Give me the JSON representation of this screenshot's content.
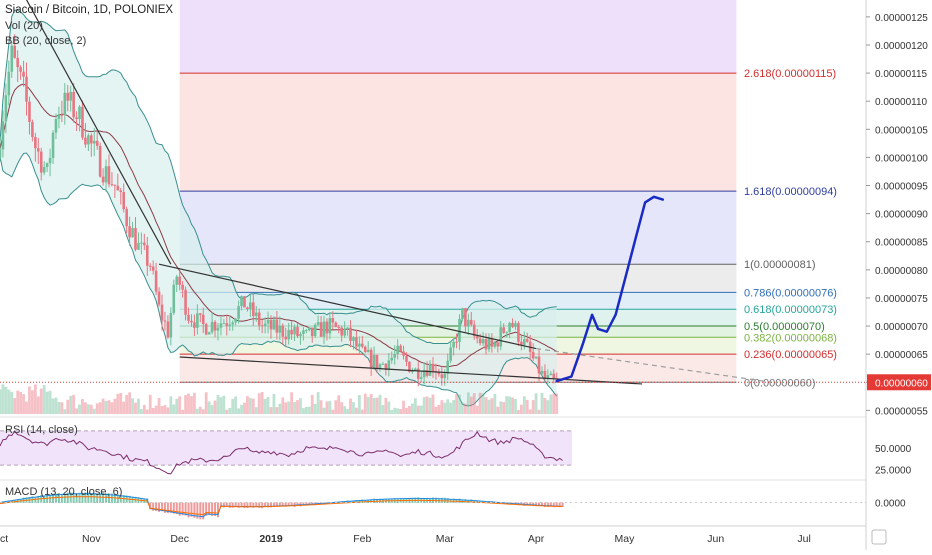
{
  "header": {
    "title": "Siacoin / Bitcoin, 1D, POLONIEX",
    "vol_label": "Vol (20)",
    "bb_label": "BB (20, close, 2)",
    "rsi_label": "RSI (14, close)",
    "macd_label": "MACD (13, 20, close, 6)"
  },
  "colors": {
    "up": "#6fbf9a",
    "down": "#e87682",
    "bb_band": "#3a8f8f",
    "bb_fill": "#d8f0ee",
    "fib_2618": "#d32f2f",
    "fib_1618": "#303f9f",
    "fib_1": "#616161",
    "fib_0786": "#2f6fb7",
    "fib_0618": "#26a69a",
    "fib_05": "#2e7d32",
    "fib_0382": "#7cb342",
    "fib_0236": "#d32f2f",
    "fib_0": "#757575",
    "projection": "#1a2bc4",
    "last_price": "#e53935",
    "rsi_line": "#7b2d6b",
    "macd_line": "#1e88e5",
    "signal_line": "#ff6d00"
  },
  "chart_data": {
    "type": "candlestick",
    "xlabels": [
      "Oct",
      "Nov",
      "Dec",
      "2019",
      "Feb",
      "Mar",
      "Apr",
      "May",
      "Jun",
      "Jul"
    ],
    "xlabel_days": [
      0,
      31,
      61,
      92,
      123,
      151,
      182,
      212,
      243,
      273
    ],
    "ylim": [
      5.4e-07,
      1.28e-06
    ],
    "yticks": [
      "0.00000055",
      "0.00000060",
      "0.00000065",
      "0.00000070",
      "0.00000075",
      "0.00000080",
      "0.00000085",
      "0.00000090",
      "0.00000095",
      "0.00000100",
      "0.00000105",
      "0.00000110",
      "0.00000115",
      "0.00000120",
      "0.00000125"
    ],
    "ytick_values": [
      5.5e-07,
      6e-07,
      6.5e-07,
      7e-07,
      7.5e-07,
      8e-07,
      8.5e-07,
      9e-07,
      9.5e-07,
      1e-06,
      1.05e-06,
      1.1e-06,
      1.15e-06,
      1.2e-06,
      1.25e-06
    ],
    "last_price_label": "0.00000060",
    "last_price": 6e-07,
    "price_path": [
      [
        0,
        1e-06
      ],
      [
        3,
        1.12e-06
      ],
      [
        5,
        1.18e-06
      ],
      [
        9,
        1.12e-06
      ],
      [
        13,
        1.02e-06
      ],
      [
        17,
        9.7e-07
      ],
      [
        20,
        1.08e-06
      ],
      [
        24,
        1.1e-06
      ],
      [
        28,
        1.07e-06
      ],
      [
        32,
        1.02e-06
      ],
      [
        36,
        9.8e-07
      ],
      [
        40,
        9.5e-07
      ],
      [
        44,
        8.9e-07
      ],
      [
        48,
        8.4e-07
      ],
      [
        52,
        8.1e-07
      ],
      [
        55,
        7.3e-07
      ],
      [
        58,
        6.9e-07
      ],
      [
        61,
        7.9e-07
      ],
      [
        65,
        7.2e-07
      ],
      [
        70,
        7e-07
      ],
      [
        78,
        7.1e-07
      ],
      [
        84,
        7.4e-07
      ],
      [
        90,
        7e-07
      ],
      [
        98,
        6.9e-07
      ],
      [
        105,
        6.8e-07
      ],
      [
        112,
        7e-07
      ],
      [
        118,
        6.9e-07
      ],
      [
        124,
        6.5e-07
      ],
      [
        130,
        6.3e-07
      ],
      [
        136,
        6.5e-07
      ],
      [
        142,
        6.2e-07
      ],
      [
        148,
        6.3e-07
      ],
      [
        152,
        6.1e-07
      ],
      [
        158,
        7.2e-07
      ],
      [
        162,
        6.8e-07
      ],
      [
        168,
        6.6e-07
      ],
      [
        174,
        7.1e-07
      ],
      [
        180,
        6.6e-07
      ],
      [
        183,
        6.3e-07
      ],
      [
        186,
        6.05e-07
      ],
      [
        189,
        6e-07
      ]
    ],
    "fib_levels": [
      {
        "label": "2.618(0.00000115)",
        "value": 1.15e-06,
        "color_key": "fib_2618"
      },
      {
        "label": "1.618(0.00000094)",
        "value": 9.4e-07,
        "color_key": "fib_1618"
      },
      {
        "label": "1(0.00000081)",
        "value": 8.1e-07,
        "color_key": "fib_1"
      },
      {
        "label": "0.786(0.00000076)",
        "value": 7.6e-07,
        "color_key": "fib_0786"
      },
      {
        "label": "0.618(0.00000073)",
        "value": 7.3e-07,
        "color_key": "fib_0618"
      },
      {
        "label": "0.5(0.00000070)",
        "value": 7e-07,
        "color_key": "fib_05"
      },
      {
        "label": "0.382(0.00000068)",
        "value": 6.8e-07,
        "color_key": "fib_0382"
      },
      {
        "label": "0.236(0.00000065)",
        "value": 6.5e-07,
        "color_key": "fib_0236"
      },
      {
        "label": "0(0.00000060)",
        "value": 6e-07,
        "color_key": "fib_0"
      }
    ],
    "fib_zones": [
      {
        "from": 1.15e-06,
        "to": 1.28e-06,
        "color": "#eee0fb"
      },
      {
        "from": 9.4e-07,
        "to": 1.15e-06,
        "color": "#fbe4e2"
      },
      {
        "from": 8.1e-07,
        "to": 9.4e-07,
        "color": "#e5e6fa"
      },
      {
        "from": 7.6e-07,
        "to": 8.1e-07,
        "color": "#ececec"
      },
      {
        "from": 7.3e-07,
        "to": 7.6e-07,
        "color": "#e1eef8"
      },
      {
        "from": 7e-07,
        "to": 7.3e-07,
        "color": "#dff2ee"
      },
      {
        "from": 6.8e-07,
        "to": 7e-07,
        "color": "#e3f3e1"
      },
      {
        "from": 6.5e-07,
        "to": 6.8e-07,
        "color": "#eff6e2"
      },
      {
        "from": 6e-07,
        "to": 6.5e-07,
        "color": "#fbe9e7"
      }
    ],
    "fib_day_range": [
      61,
      250
    ],
    "trendlines": [
      {
        "from": [
          8,
          1.29e-06
        ],
        "to": [
          58,
          8.1e-07
        ],
        "style": "solid"
      },
      {
        "from": [
          54,
          8.1e-07
        ],
        "to": [
          182,
          6.6e-07
        ],
        "style": "solid"
      },
      {
        "from": [
          182,
          6.6e-07
        ],
        "to": [
          262,
          6e-07
        ],
        "style": "dashed"
      },
      {
        "from": [
          61,
          6.45e-07
        ],
        "to": [
          218,
          5.97e-07
        ],
        "style": "solid"
      }
    ],
    "projection": [
      [
        189,
        6.02e-07
      ],
      [
        194,
        6.1e-07
      ],
      [
        198,
        6.7e-07
      ],
      [
        201,
        7.2e-07
      ],
      [
        203,
        6.95e-07
      ],
      [
        206,
        6.9e-07
      ],
      [
        209,
        7.2e-07
      ],
      [
        212,
        7.8e-07
      ],
      [
        216,
        8.6e-07
      ],
      [
        219,
        9.2e-07
      ],
      [
        222,
        9.3e-07
      ],
      [
        225,
        9.25e-07
      ]
    ],
    "rsi": {
      "yticks": [
        "50.0000",
        "25.0000"
      ],
      "ytick_values": [
        50,
        25
      ],
      "upper_band": 70,
      "lower_band": 30,
      "ylim": [
        15,
        85
      ],
      "values": [
        [
          0,
          55
        ],
        [
          5,
          70
        ],
        [
          10,
          60
        ],
        [
          15,
          54
        ],
        [
          20,
          62
        ],
        [
          25,
          58
        ],
        [
          30,
          50
        ],
        [
          35,
          48
        ],
        [
          40,
          42
        ],
        [
          45,
          37
        ],
        [
          50,
          34
        ],
        [
          55,
          25
        ],
        [
          58,
          22
        ],
        [
          61,
          32
        ],
        [
          65,
          35
        ],
        [
          72,
          36
        ],
        [
          78,
          40
        ],
        [
          82,
          52
        ],
        [
          86,
          44
        ],
        [
          92,
          46
        ],
        [
          98,
          42
        ],
        [
          104,
          50
        ],
        [
          110,
          48
        ],
        [
          115,
          52
        ],
        [
          120,
          45
        ],
        [
          126,
          42
        ],
        [
          132,
          48
        ],
        [
          136,
          40
        ],
        [
          142,
          46
        ],
        [
          148,
          42
        ],
        [
          152,
          40
        ],
        [
          158,
          58
        ],
        [
          162,
          68
        ],
        [
          166,
          60
        ],
        [
          170,
          56
        ],
        [
          176,
          62
        ],
        [
          180,
          55
        ],
        [
          184,
          42
        ],
        [
          188,
          38
        ],
        [
          191,
          37
        ]
      ]
    },
    "macd": {
      "yticks": [
        "0.0000"
      ],
      "ytick_values": [
        0
      ],
      "ylim": [
        -1,
        1
      ]
    }
  }
}
